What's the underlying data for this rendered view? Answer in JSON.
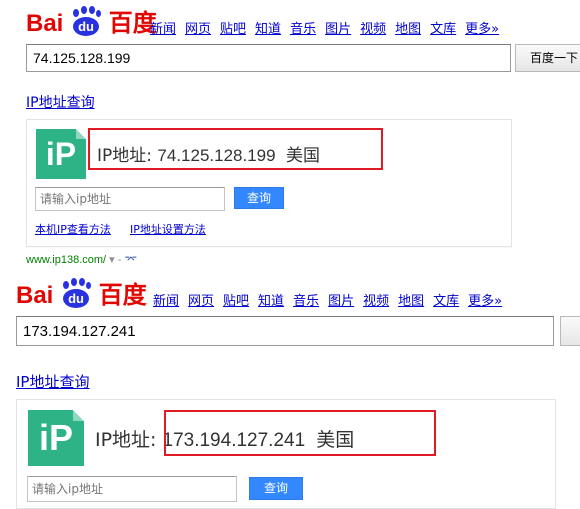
{
  "logo": {
    "left": "Bai",
    "paw_text": "du",
    "right": "百度"
  },
  "nav": [
    "新闻",
    "网页",
    "贴吧",
    "知道",
    "音乐",
    "图片",
    "视频",
    "地图",
    "文库",
    "更多»"
  ],
  "search_button_label": "百度一下",
  "result_title": "IP地址查询",
  "ip_icon_text": "iP",
  "ip_prefix": "IP地址:",
  "ip_input_placeholder": "请输入ip地址",
  "query_button_label": "查询",
  "links": {
    "local_ip_method": "本机IP查看方法",
    "ip_settings_method": "IP地址设置方法"
  },
  "result_url": {
    "url": "www.ip138.com/",
    "sep": " ▾ - ",
    "snapshot_icon": "⌤"
  },
  "top": {
    "search_value": "74.125.128.199",
    "ip_value": "74.125.128.199",
    "country": "美国"
  },
  "bottom": {
    "search_value": "173.194.127.241",
    "ip_value": "173.194.127.241",
    "country": "美国"
  },
  "colors": {
    "baidu_red": "#e10601",
    "baidu_blue": "#2932e1",
    "link": "#0000cc",
    "highlight_box": "#e01b24",
    "ip_icon": "#2db385",
    "query_button": "#3388ff"
  }
}
